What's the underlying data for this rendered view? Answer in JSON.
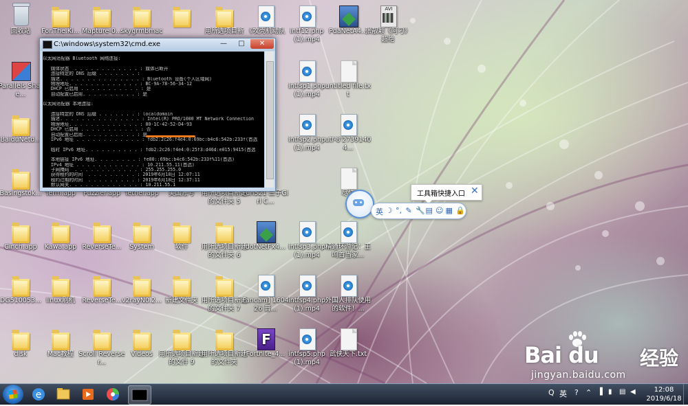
{
  "desktop_icons": [
    {
      "label": "回收站",
      "type": "recycle"
    },
    {
      "label": "For.The.Ki...",
      "type": "folder"
    },
    {
      "label": "Mapture-0...",
      "type": "folder"
    },
    {
      "label": "skygrmbmac",
      "type": "folder"
    },
    {
      "label": "",
      "type": "folder"
    },
    {
      "label": "用所选项目新",
      "type": "folder"
    },
    {
      "label": "《攻壳机动队",
      "type": "media"
    },
    {
      "label": "intf12.php (1).mp4",
      "type": "media"
    },
    {
      "label": "PdaNetA4...",
      "type": "installer"
    },
    {
      "label": "张靓颖《阿刁》超绝",
      "type": "avi"
    },
    {
      "label": "Parallels Share...",
      "type": "parallels"
    },
    {
      "label": "intfsp1.php (1).mp4",
      "type": "media"
    },
    {
      "label": "untitled file.txt",
      "type": "doc"
    },
    {
      "label": "BaiduNetd...",
      "type": "folder"
    },
    {
      "label": "intfsp2.php (1).mp4",
      "type": "media"
    },
    {
      "label": "utf-8'273914​04...",
      "type": "media"
    },
    {
      "label": "Basingstok...",
      "type": "folder"
    },
    {
      "label": "Term.app",
      "type": "folder"
    },
    {
      "label": "Puzzler.app",
      "type": "folder"
    },
    {
      "label": "Tether.app",
      "type": "folder"
    },
    {
      "label": "美国账号",
      "type": "folder"
    },
    {
      "label": "用所选项目新建的文件夹 5",
      "type": "folder"
    },
    {
      "label": "Fun521 三子Girl C...",
      "type": "folder"
    },
    {
      "label": "尽快",
      "type": "doc"
    },
    {
      "label": "Cinch.app",
      "type": "folder"
    },
    {
      "label": "Kawa.app",
      "type": "folder"
    },
    {
      "label": "ReverseTe...",
      "type": "folder"
    },
    {
      "label": "System",
      "type": "folder"
    },
    {
      "label": "软件",
      "type": "folder"
    },
    {
      "label": "用所选项目新建的文件夹 6",
      "type": "folder"
    },
    {
      "label": "dotNetFx4...",
      "type": "installer"
    },
    {
      "label": "intfsp3.php (1).mp4",
      "type": "media"
    },
    {
      "label": "精通环游记：王鸣首当家...",
      "type": "media"
    },
    {
      "label": "DG510053...",
      "type": "folder"
    },
    {
      "label": "linux刷机",
      "type": "folder"
    },
    {
      "label": "ReverseTe...",
      "type": "folder"
    },
    {
      "label": "v2rayN0.2...",
      "type": "folder"
    },
    {
      "label": "新建文件夹",
      "type": "folder"
    },
    {
      "label": "用所选项目新建的文件夹 7",
      "type": "folder"
    },
    {
      "label": "Fancam] 160426 晋...",
      "type": "media"
    },
    {
      "label": "intfsp4.php (1).mp4",
      "type": "media"
    },
    {
      "label": "外国人排队使用的软件！...",
      "type": "media"
    },
    {
      "label": "disk",
      "type": "folder"
    },
    {
      "label": "Mac教程",
      "type": "folder"
    },
    {
      "label": "Scroll Reverser...",
      "type": "folder"
    },
    {
      "label": "Videos",
      "type": "folder"
    },
    {
      "label": "用所选项目新建的文件 9",
      "type": "folder"
    },
    {
      "label": "用所选项目新建的文件夹",
      "type": "folder"
    },
    {
      "label": "Fortnite_4...",
      "type": "fort"
    },
    {
      "label": "intfsp5.php (1).mp4",
      "type": "media"
    },
    {
      "label": "武侠天下.txt",
      "type": "doc"
    }
  ],
  "cmd": {
    "title": "C:\\windows\\system32\\cmd.exe",
    "min": "—",
    "max": "□",
    "close": "✕",
    "lines": [
      "",
      "以太网适配器 Bluetooth 网络连接:",
      "",
      "   媒体状态  . . . . . . . . . . . . : 媒体已断开",
      "   连接特定的 DNS 后缀 . . . . . . . :",
      "   描述. . . . . . . . . . . . . . . : Bluetooth 设备(个人区域网)",
      "   物理地址. . . . . . . . . . . . . : BC-9A-78-56-34-12",
      "   DHCP 已启用 . . . . . . . . . . . : 是",
      "   自动配置已启用. . . . . . . . . . : 是",
      "",
      "以太网适配器 本地连接:",
      "",
      "   连接特定的 DNS 后缀 . . . . . . . : localdomain",
      "   描述. . . . . . . . . . . . . . . : Intel(R) PRO/1000 MT Network Connection",
      "   物理地址. . . . . . . . . . . . . : 00-1C-42-52-D4-93",
      "   DHCP 已启用 . . . . . . . . . . . : 否",
      "   自动配置已启用. . . . . . . . . . : 是",
      "   IPv6 地址 . . . . . . . . . . . . : fdb2:2c26:f4e4:0:69bc:b4c6:542b:233f(首选",
      "",
      "   临时 IPv6 地址. . . . . . . . . . : fdb2:2c26:f4e4:0:25f3:d46d:e015:9415(首选",
      "",
      "   本地链接 IPv6 地址. . . . . . . . : fe80::69bc:b4c6:542b:233f%11(首选)",
      "   IPv4 地址 . . . . . . . . . . . . : 10.211.55.11(首选)",
      "   子网掩码  . . . . . . . . . . . . : 255.255.255.0",
      "   获得租约的时间  . . . . . . . . . : 2019年6月18日 12:07:11",
      "   租约过期的时间  . . . . . . . . . : 2019年6月18日 12:37:11",
      "   默认网关. . . . . . . . . . . . . : 10.211.55.1"
    ]
  },
  "toolbox": {
    "tooltip": "工具箱快捷入口",
    "close": "✕",
    "items": [
      "英",
      "☽",
      "°,",
      "✎",
      "🔧",
      "▤",
      "☺",
      "▦",
      "🔒"
    ]
  },
  "watermark": {
    "brand": "Bai du",
    "cn": "经验",
    "url": "jingyan.baidu.com"
  },
  "taskbar": {
    "tray": [
      "Q",
      "英",
      "?",
      "⌃"
    ],
    "time": "12:08",
    "date": "2019/6/18"
  },
  "colors": {
    "highlight": "#f07a1e",
    "taskbar": "#1e2a3c",
    "console_bg": "#000000"
  }
}
